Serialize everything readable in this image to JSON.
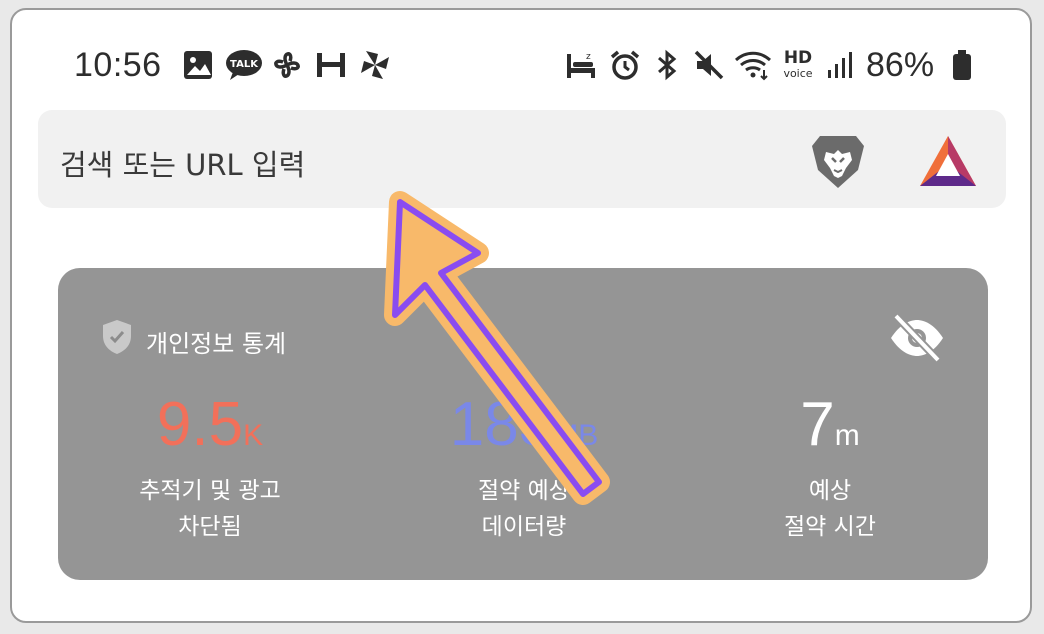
{
  "status_bar": {
    "time": "10:56",
    "battery_percent": "86%",
    "hd_voice_top": "HD",
    "hd_voice_bottom": "voice",
    "talk_badge": "TALK",
    "left_icons": [
      "gallery-icon",
      "kakaotalk-icon",
      "fan-icon",
      "h-icon",
      "pinwheel-icon"
    ],
    "right_icons": [
      "bed-icon",
      "alarm-icon",
      "bluetooth-icon",
      "mute-icon",
      "wifi-icon",
      "hd-voice-icon",
      "signal-icon",
      "battery-icon"
    ]
  },
  "url_bar": {
    "placeholder": "검색 또는 URL 입력",
    "icons": [
      "brave-lion-icon",
      "bat-rewards-icon"
    ]
  },
  "privacy_card": {
    "title": "개인정보 통계",
    "icons": [
      "shield-check-icon",
      "eye-off-icon"
    ],
    "stats": [
      {
        "value": "9.5",
        "unit": "K",
        "label_line1": "추적기 및 광고",
        "label_line2": "차단됨",
        "color": "#f2705a"
      },
      {
        "value": "183",
        "unit": "MB",
        "label_line1": "절약 예상",
        "label_line2": "데이터량",
        "color": "#7a88e8"
      },
      {
        "value": "7",
        "unit": "m",
        "label_line1": "예상",
        "label_line2": "절약 시간",
        "color": "#ffffff"
      }
    ]
  },
  "colors": {
    "card_bg": "#959595",
    "url_bar_bg": "#f1f1f1",
    "arrow_fill": "#8a4cf0",
    "arrow_outline": "#f8b96a"
  }
}
